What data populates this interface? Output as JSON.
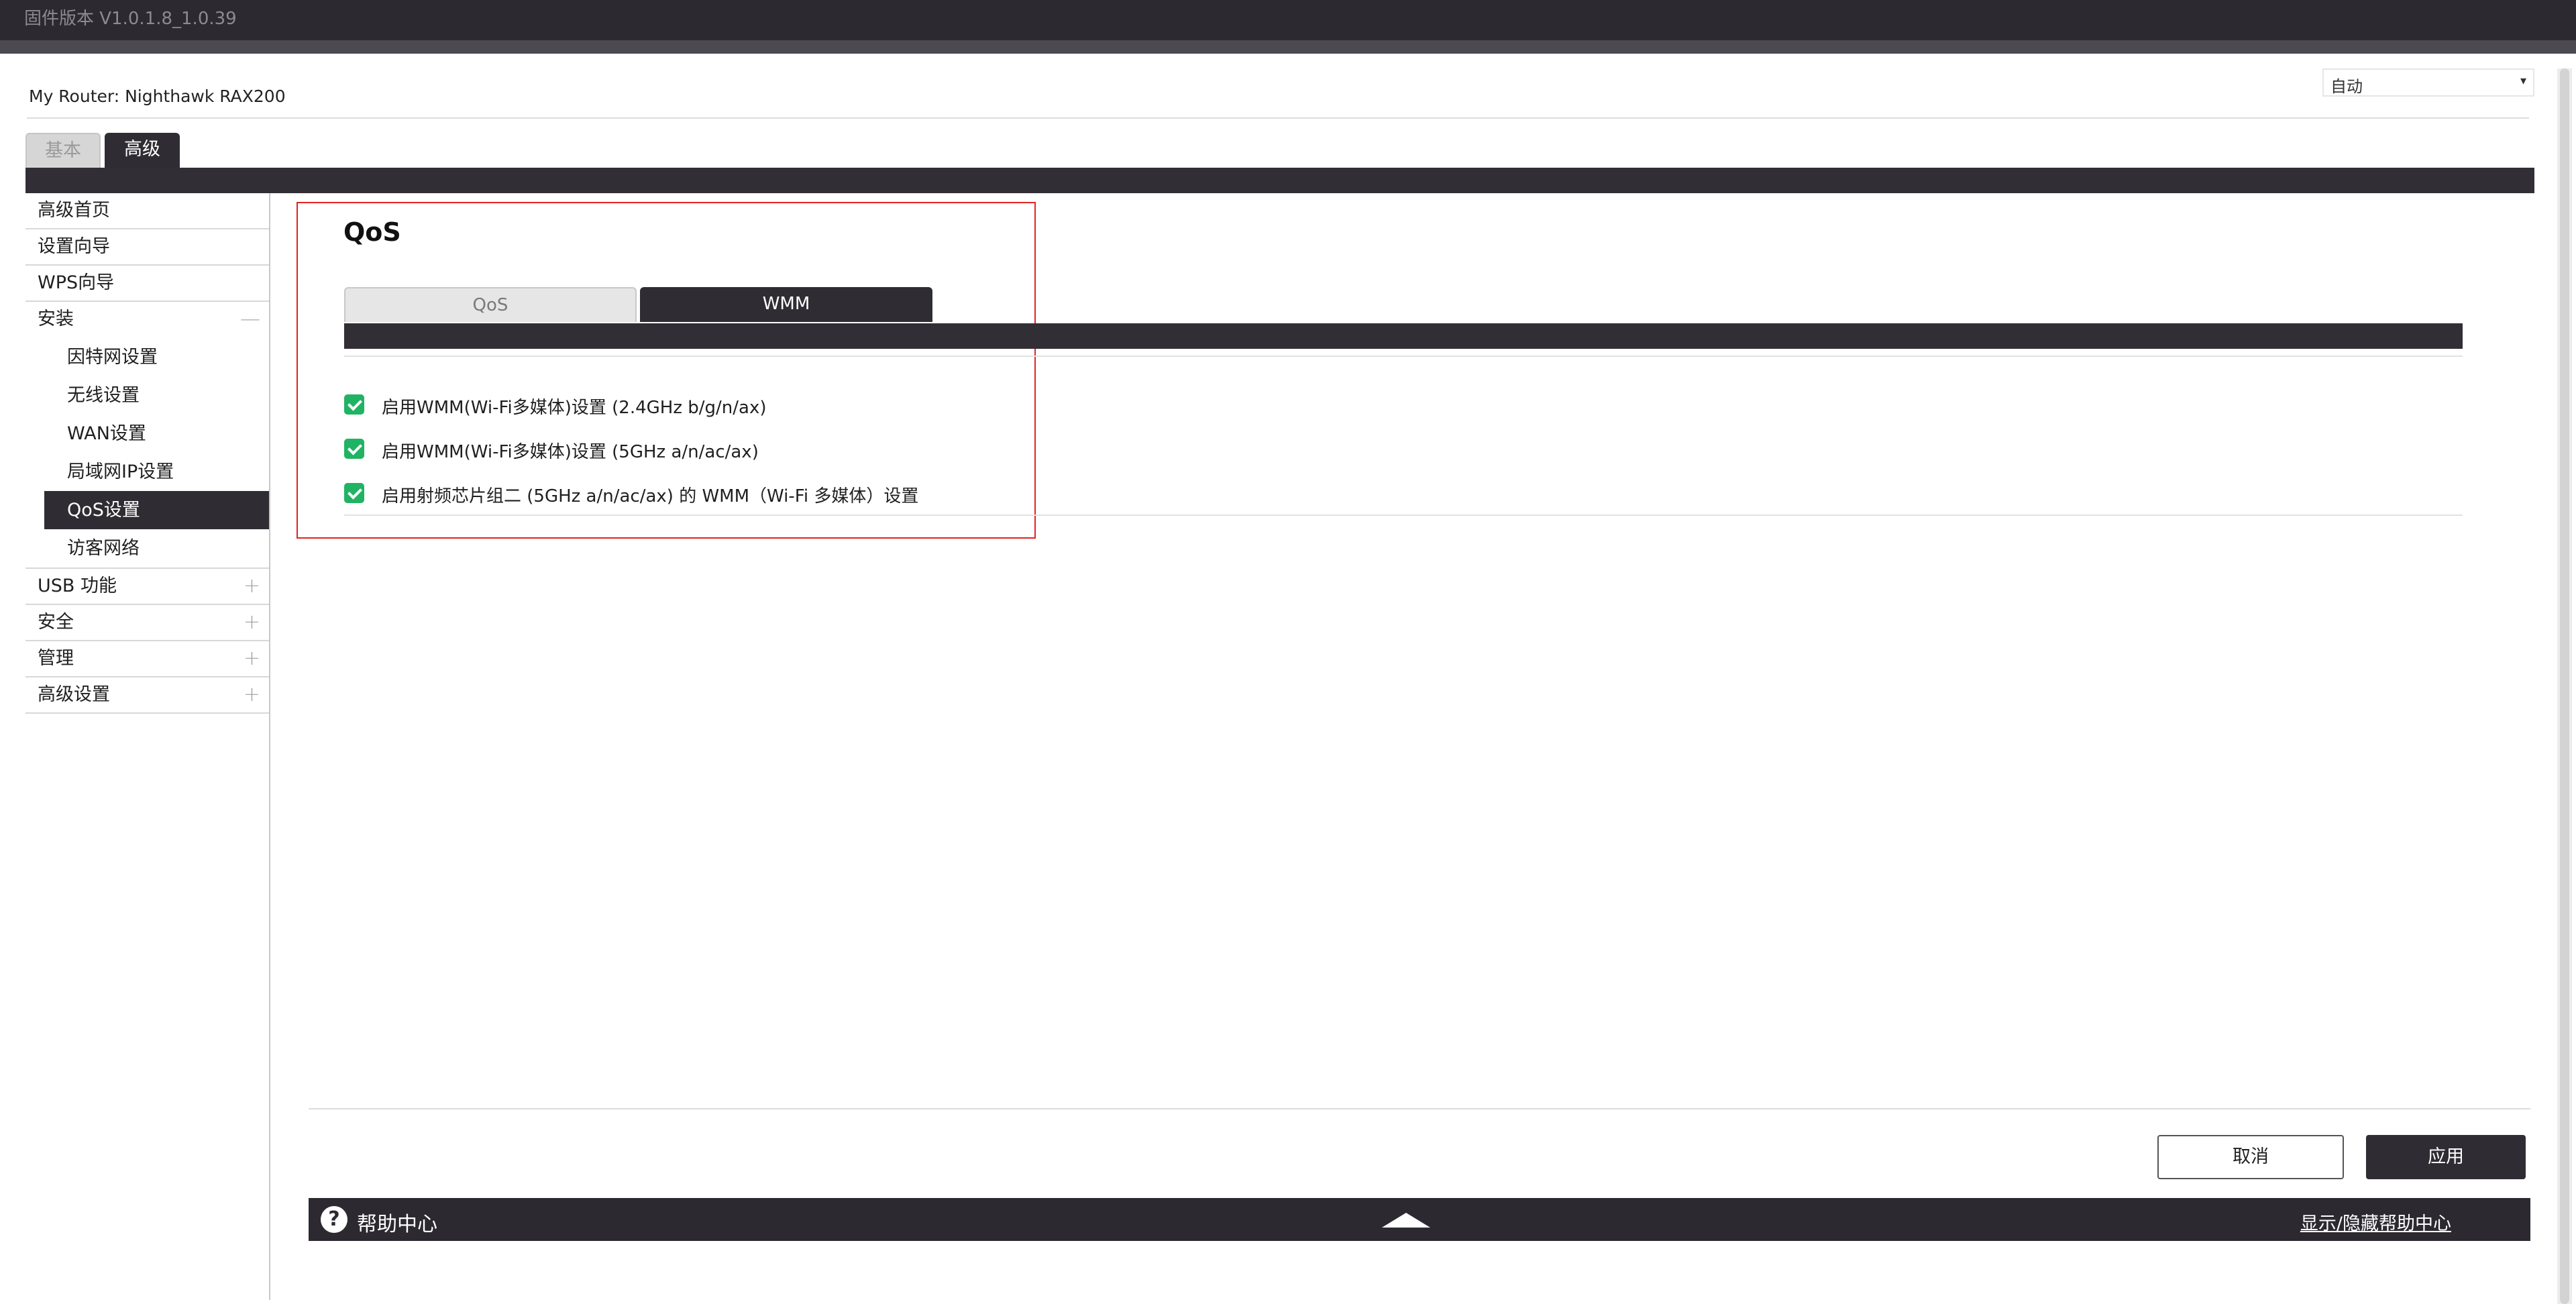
{
  "header": {
    "firmware": "固件版本 V1.0.1.8_1.0.39"
  },
  "router": {
    "label": "My Router:",
    "name": "Nighthawk RAX200"
  },
  "language": {
    "selected": "自动",
    "arrow": "▾"
  },
  "main_tabs": [
    {
      "label": "基本"
    },
    {
      "label": "高级"
    }
  ],
  "sidebar": {
    "items": [
      {
        "label": "高级首页"
      },
      {
        "label": "设置向导"
      },
      {
        "label": "WPS向导"
      },
      {
        "label": "安装",
        "toggle": "—"
      },
      {
        "label": "USB 功能",
        "toggle": "+"
      },
      {
        "label": "安全",
        "toggle": "+"
      },
      {
        "label": "管理",
        "toggle": "+"
      },
      {
        "label": "高级设置",
        "toggle": "+"
      }
    ],
    "install_subitems": [
      {
        "label": "因特网设置"
      },
      {
        "label": "无线设置"
      },
      {
        "label": "WAN设置"
      },
      {
        "label": "局域网IP设置"
      },
      {
        "label": "QoS设置"
      },
      {
        "label": "访客网络"
      }
    ]
  },
  "qos": {
    "title": "QoS",
    "tabs": [
      {
        "label": "QoS"
      },
      {
        "label": "WMM"
      }
    ],
    "options": [
      {
        "label": "启用WMM(Wi-Fi多媒体)设置 (2.4GHz b/g/n/ax)",
        "checked": true
      },
      {
        "label": "启用WMM(Wi-Fi多媒体)设置 (5GHz a/n/ac/ax)",
        "checked": true
      },
      {
        "label": "启用射频芯片组二 (5GHz a/n/ac/ax) 的 WMM（Wi-Fi 多媒体）设置",
        "checked": true
      }
    ]
  },
  "buttons": {
    "cancel": "取消",
    "apply": "应用"
  },
  "help": {
    "icon": "?",
    "title": "帮助中心",
    "toggle": "显示/隐藏帮助中心"
  },
  "colors": {
    "dark": "#2f2d33",
    "check": "#21b364",
    "highlight_border": "#e02424"
  }
}
